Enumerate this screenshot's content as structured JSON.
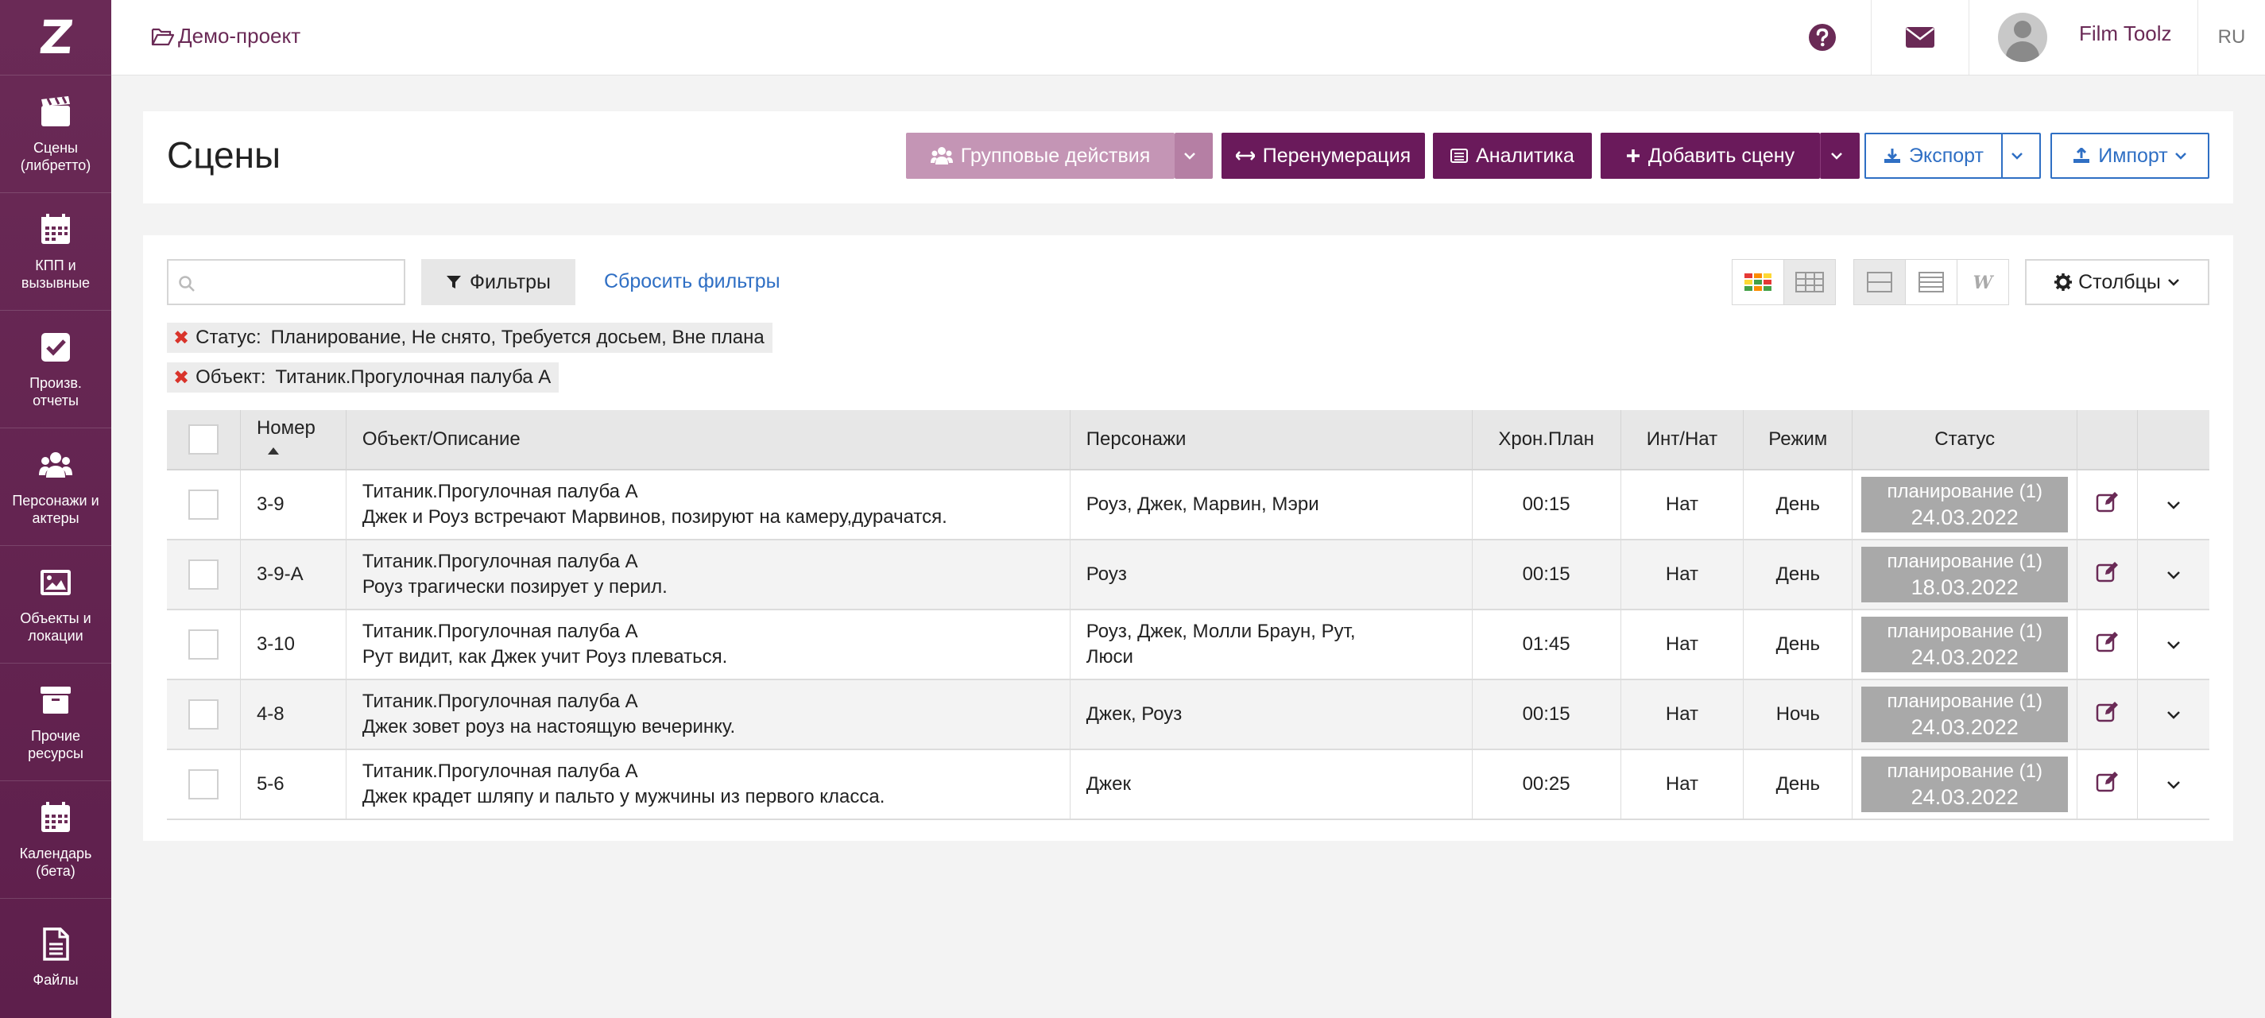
{
  "sidebar": {
    "logo": "Z",
    "items": [
      {
        "label": "Сцены\n(либретто)",
        "icon": "clapperboard-icon"
      },
      {
        "label": "КПП и\nвызывные",
        "icon": "calendar-icon"
      },
      {
        "label": "Произв. отчеты",
        "icon": "checkbox-icon"
      },
      {
        "label": "Персонажи и\nактеры",
        "icon": "users-icon"
      },
      {
        "label": "Объекты и\nлокации",
        "icon": "image-icon"
      },
      {
        "label": "Прочие\nресурсы",
        "icon": "archive-icon"
      },
      {
        "label": "Календарь\n(бета)",
        "icon": "calendar-icon"
      },
      {
        "label": "Файлы",
        "icon": "file-icon"
      }
    ]
  },
  "topbar": {
    "project": "Демо-проект",
    "username": "Film Toolz",
    "language": "RU"
  },
  "header": {
    "title": "Сцены",
    "group_actions": "Групповые действия",
    "renumber": "Перенумерация",
    "analytics": "Аналитика",
    "add_scene": "Добавить сцену",
    "export": "Экспорт",
    "import": "Импорт"
  },
  "toolbar": {
    "search_placeholder": "",
    "filters": "Фильтры",
    "reset_filters": "Сбросить фильтры",
    "columns": "Столбцы"
  },
  "active_filters": [
    {
      "label": "Статус:",
      "value": "Планирование, Не снято, Требуется досьем, Вне плана"
    },
    {
      "label": "Объект:",
      "value": "Титаник.Прогулочная палуба А"
    }
  ],
  "table": {
    "headers": [
      "Номер",
      "Объект/Описание",
      "Персонажи",
      "Хрон.План",
      "Инт/Нат",
      "Режим",
      "Статус"
    ],
    "rows": [
      {
        "num": "3-9",
        "object": "Титаник.Прогулочная палуба А",
        "desc": "Джек и Роуз встречают Марвинов, позируют на камеру,дурачатся.",
        "chars": "Роуз, Джек, Марвин, Мэри",
        "time": "00:15",
        "intnat": "Нат",
        "mode": "День",
        "status": "планирование (1)",
        "date": "24.03.2022"
      },
      {
        "num": "3-9-А",
        "object": "Титаник.Прогулочная палуба А",
        "desc": "Роуз трагически позирует у перил.",
        "chars": "Роуз",
        "time": "00:15",
        "intnat": "Нат",
        "mode": "День",
        "status": "планирование (1)",
        "date": "18.03.2022"
      },
      {
        "num": "3-10",
        "object": "Титаник.Прогулочная палуба А",
        "desc": "Рут видит, как Джек учит Роуз плеваться.",
        "chars": "Роуз, Джек, Молли Браун, Рут,\nЛюси",
        "time": "01:45",
        "intnat": "Нат",
        "mode": "День",
        "status": "планирование (1)",
        "date": "24.03.2022"
      },
      {
        "num": "4-8",
        "object": "Титаник.Прогулочная палуба А",
        "desc": "Джек зовет роуз на настоящую вечеринку.",
        "chars": "Джек, Роуз",
        "time": "00:15",
        "intnat": "Нат",
        "mode": "Ночь",
        "status": "планирование (1)",
        "date": "24.03.2022"
      },
      {
        "num": "5-6",
        "object": "Титаник.Прогулочная палуба А",
        "desc": "Джек крадет шляпу и пальто у мужчины из первого класса.",
        "chars": "Джек",
        "time": "00:25",
        "intnat": "Нат",
        "mode": "День",
        "status": "планирование (1)",
        "date": "24.03.2022"
      }
    ]
  }
}
